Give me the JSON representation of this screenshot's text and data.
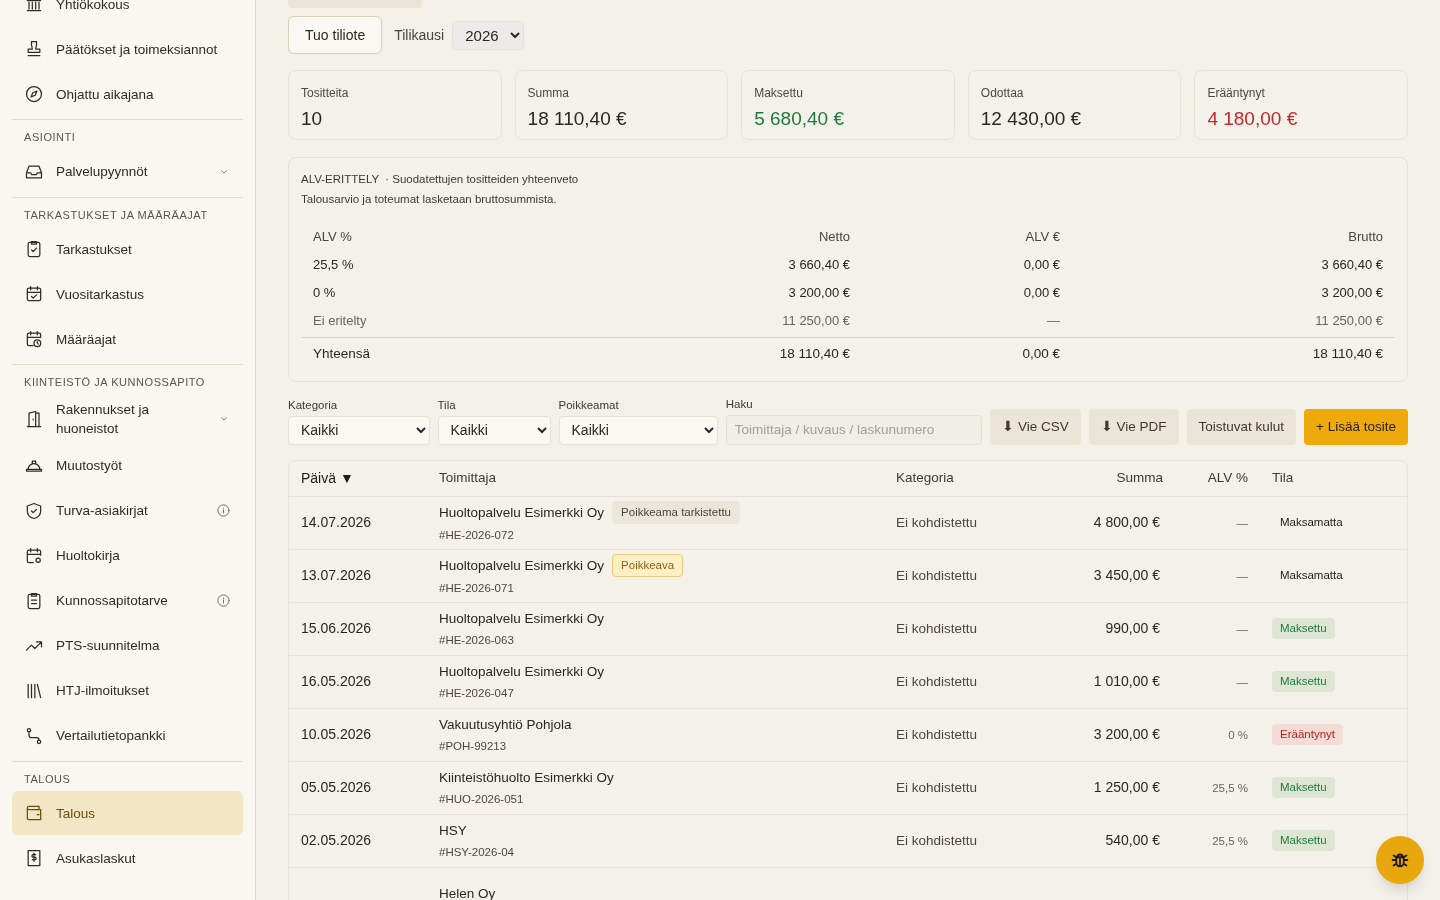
{
  "sidebar": {
    "groups": [
      {
        "items": [
          {
            "label": "Yhtiökokous",
            "kind": "link",
            "selected": false
          },
          {
            "label": "Päätökset ja toimeksiannot",
            "kind": "link",
            "selected": false
          },
          {
            "label": "Ohjattu aikajana",
            "kind": "link",
            "selected": false
          }
        ]
      },
      {
        "heading": "ASIOINTI",
        "items": [
          {
            "label": "Palvelupyynnöt",
            "kind": "group",
            "expanded": false,
            "selected": false
          }
        ]
      },
      {
        "heading": "TARKASTUKSET JA MÄÄRÄAJAT",
        "items": [
          {
            "label": "Tarkastukset",
            "kind": "link",
            "selected": false
          },
          {
            "label": "Vuositarkastus",
            "kind": "link",
            "selected": false
          },
          {
            "label": "Määräajat",
            "kind": "link",
            "selected": false
          }
        ]
      },
      {
        "heading": "KIINTEISTÖ JA KUNNOSSAPITO",
        "items": [
          {
            "label": "Rakennukset ja huoneistot",
            "kind": "group",
            "expanded": false,
            "selected": false
          },
          {
            "label": "Muutostyöt",
            "kind": "link",
            "selected": false
          },
          {
            "label": "Turva-asiakirjat",
            "kind": "info",
            "selected": false
          },
          {
            "label": "Huoltokirja",
            "kind": "link",
            "selected": false
          },
          {
            "label": "Kunnossapitotarve",
            "kind": "info",
            "selected": false
          },
          {
            "label": "PTS-suunnitelma",
            "kind": "link",
            "selected": false
          },
          {
            "label": "HTJ-ilmoitukset",
            "kind": "link",
            "selected": false
          },
          {
            "label": "Vertailutietopankki",
            "kind": "link",
            "selected": false
          }
        ]
      },
      {
        "heading": "TALOUS",
        "items": [
          {
            "label": "Talous",
            "kind": "link",
            "selected": true
          },
          {
            "label": "Asukaslaskut",
            "kind": "link",
            "selected": false
          }
        ]
      }
    ]
  },
  "toolbar": {
    "import_button": "Tuo tiliote",
    "period_label": "Tilikausi",
    "period_value": "2026"
  },
  "stats": [
    {
      "label": "Tositteita",
      "value": "10",
      "kind": "neutral"
    },
    {
      "label": "Summa",
      "value": "18 110,40 €",
      "kind": "neutral"
    },
    {
      "label": "Maksettu",
      "value": "5 680,40 €",
      "kind": "positive"
    },
    {
      "label": "Odottaa",
      "value": "12 430,00 €",
      "kind": "neutral"
    },
    {
      "label": "Erääntynyt",
      "value": "4 180,00 €",
      "kind": "negative"
    }
  ],
  "vat": {
    "title": "ALV-ERITTELY",
    "subtitle": "· Suodatettujen tositteiden yhteenveto",
    "note": "Talousarvio ja toteumat lasketaan bruttosummista.",
    "columns": [
      "ALV %",
      "Netto",
      "ALV €",
      "Brutto"
    ],
    "rows": [
      [
        "25,5 %",
        "3 660,40 €",
        "0,00 €",
        "3 660,40 €"
      ],
      [
        "0 %",
        "3 200,00 €",
        "0,00 €",
        "3 200,00 €"
      ],
      [
        "Ei eritelty",
        "11 250,00 €",
        "—",
        "11 250,00 €"
      ]
    ],
    "total": [
      "Yhteensä",
      "18 110,40 €",
      "0,00 €",
      "18 110,40 €"
    ]
  },
  "filters": [
    {
      "label": "Kategoria",
      "value": "Kaikki"
    },
    {
      "label": "Tila",
      "value": "Kaikki"
    },
    {
      "label": "Poikkeamat",
      "value": "Kaikki"
    }
  ],
  "search": {
    "label": "Haku",
    "placeholder": "Toimittaja / kuvaus / laskunumero"
  },
  "actions": [
    {
      "label": "⬇ Vie CSV",
      "kind": "secondary"
    },
    {
      "label": "⬇ Vie PDF",
      "kind": "secondary"
    },
    {
      "label": "Toistuvat kulut",
      "kind": "secondary"
    },
    {
      "label": "+ Lisää tosite",
      "kind": "primary"
    }
  ],
  "table": {
    "columns": [
      "Päivä ▼",
      "Toimittaja",
      "Kategoria",
      "Summa",
      "ALV %",
      "Tila"
    ],
    "rows": [
      {
        "date": "14.07.2026",
        "supplier": "Huoltopalvelu Esimerkki Oy",
        "tag": {
          "label": "Poikkeama tarkistettu",
          "kind": "checked"
        },
        "invoice": "#HE-2026-072",
        "category": "Ei kohdistettu",
        "amount": "4 800,00 €",
        "vat": "—",
        "status": {
          "label": "Maksamatta",
          "kind": "unpaid"
        }
      },
      {
        "date": "13.07.2026",
        "supplier": "Huoltopalvelu Esimerkki Oy",
        "tag": {
          "label": "Poikkeava",
          "kind": "deviation"
        },
        "invoice": "#HE-2026-071",
        "category": "Ei kohdistettu",
        "amount": "3 450,00 €",
        "vat": "—",
        "status": {
          "label": "Maksamatta",
          "kind": "unpaid"
        }
      },
      {
        "date": "15.06.2026",
        "supplier": "Huoltopalvelu Esimerkki Oy",
        "invoice": "#HE-2026-063",
        "category": "Ei kohdistettu",
        "amount": "990,00 €",
        "vat": "—",
        "status": {
          "label": "Maksettu",
          "kind": "paid"
        }
      },
      {
        "date": "16.05.2026",
        "supplier": "Huoltopalvelu Esimerkki Oy",
        "invoice": "#HE-2026-047",
        "category": "Ei kohdistettu",
        "amount": "1 010,00 €",
        "vat": "—",
        "status": {
          "label": "Maksettu",
          "kind": "paid"
        }
      },
      {
        "date": "10.05.2026",
        "supplier": "Vakuutusyhtiö Pohjola",
        "invoice": "#POH-99213",
        "category": "Ei kohdistettu",
        "amount": "3 200,00 €",
        "vat": "0 %",
        "status": {
          "label": "Erääntynyt",
          "kind": "overdue"
        }
      },
      {
        "date": "05.05.2026",
        "supplier": "Kiinteistöhuolto Esimerkki Oy",
        "invoice": "#HUO-2026-051",
        "category": "Ei kohdistettu",
        "amount": "1 250,00 €",
        "vat": "25,5 %",
        "status": {
          "label": "Maksettu",
          "kind": "paid"
        }
      },
      {
        "date": "02.05.2026",
        "supplier": "HSY",
        "invoice": "#HSY-2026-04",
        "category": "Ei kohdistettu",
        "amount": "540,00 €",
        "vat": "25,5 %",
        "status": {
          "label": "Maksettu",
          "kind": "paid"
        }
      },
      {
        "supplier": "Helen Oy"
      }
    ]
  }
}
